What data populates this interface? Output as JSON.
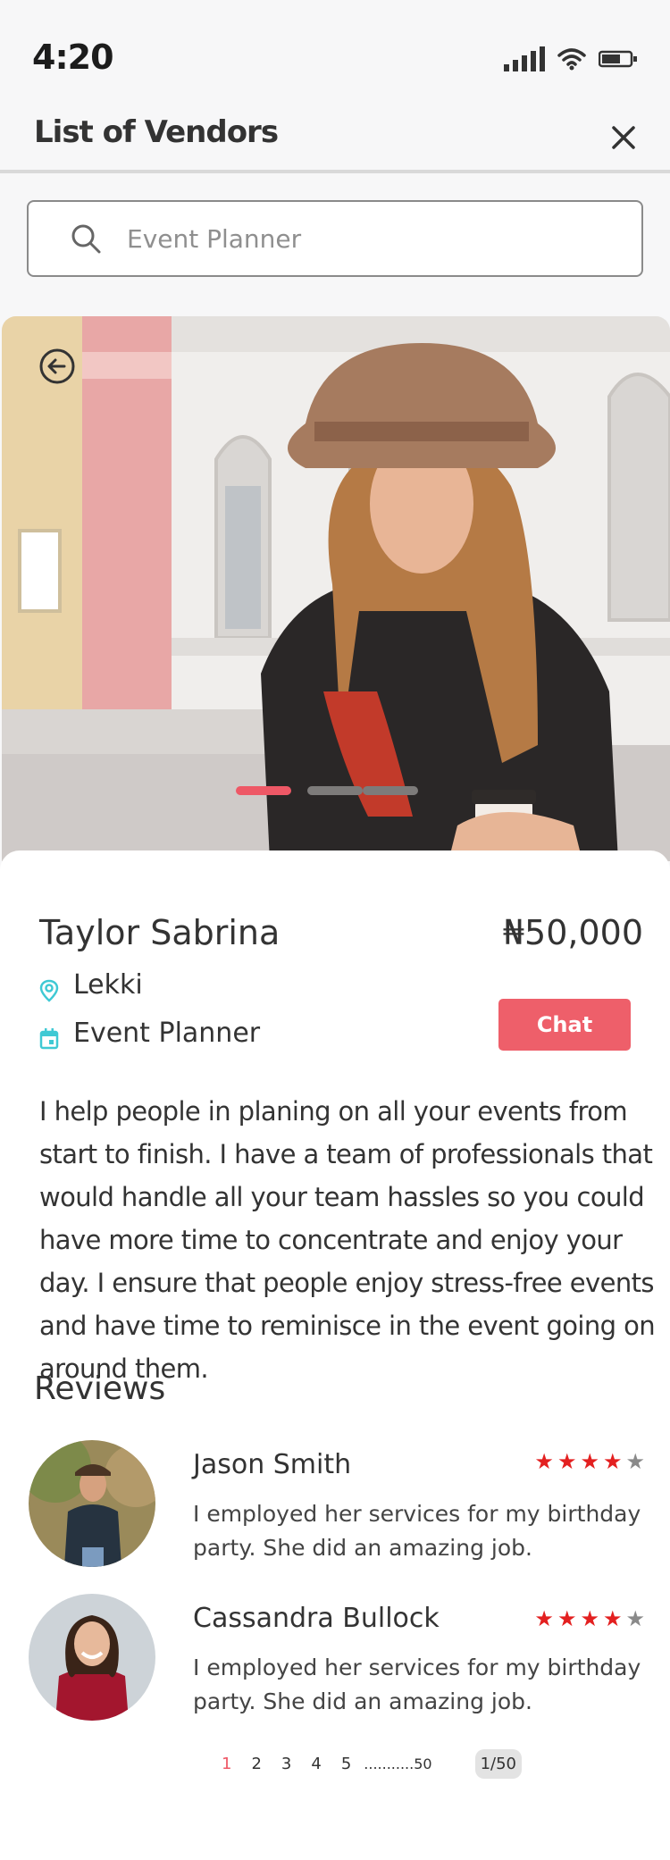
{
  "status_bar": {
    "time": "4:20"
  },
  "header": {
    "title": "List of Vendors"
  },
  "search": {
    "value": "",
    "placeholder": "Event Planner"
  },
  "carousel": {
    "slides": 3,
    "active_index": 0
  },
  "vendor": {
    "name": "Taylor Sabrina",
    "price": "₦50,000",
    "location": "Lekki",
    "category": "Event Planner",
    "chat_label": "Chat",
    "description": "I help people in planing on all your events from start to finish. I have a team of professionals that would handle all your team hassles so you could have more time to concentrate and enjoy your day. I ensure that people enjoy stress-free events and have time to reminisce in the event going on around them."
  },
  "reviews": {
    "title": "Reviews",
    "items": [
      {
        "name": "Jason Smith",
        "rating": 4,
        "max_rating": 5,
        "text": "I employed her services for my birthday party. She did an amazing job."
      },
      {
        "name": "Cassandra Bullock",
        "rating": 4,
        "max_rating": 5,
        "text": "I employed her services for my birthday party. She did an amazing job."
      }
    ]
  },
  "pagination": {
    "pages": [
      "1",
      "2",
      "3",
      "4",
      "5"
    ],
    "ellipsis": "...........50",
    "active": "1",
    "indicator": "1/50"
  },
  "colors": {
    "accent": "#ee5f6a",
    "star": "#e32020",
    "icon_teal": "#3fc9d4"
  },
  "icons": {
    "close": "close-icon",
    "search": "search-icon",
    "back": "back-arrow-icon",
    "location": "location-pin-icon",
    "category": "calendar-icon"
  }
}
